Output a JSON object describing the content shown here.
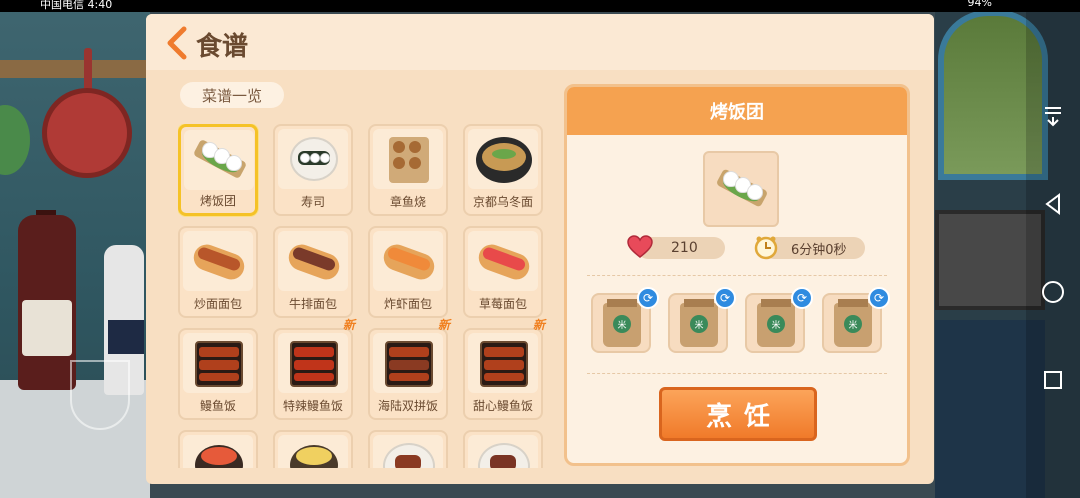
{
  "status_bar": {
    "carrier_time": "中国电信 4:40",
    "battery": "94%"
  },
  "header": {
    "title": "食谱"
  },
  "recipe_list": {
    "label": "菜谱一览",
    "new_badge": "新",
    "items": [
      {
        "name": "烤饭团",
        "selected": true,
        "is_new": false
      },
      {
        "name": "寿司",
        "selected": false,
        "is_new": false
      },
      {
        "name": "章鱼烧",
        "selected": false,
        "is_new": false
      },
      {
        "name": "京都乌冬面",
        "selected": false,
        "is_new": false
      },
      {
        "name": "炒面面包",
        "selected": false,
        "is_new": false
      },
      {
        "name": "牛排面包",
        "selected": false,
        "is_new": false
      },
      {
        "name": "炸虾面包",
        "selected": false,
        "is_new": false
      },
      {
        "name": "草莓面包",
        "selected": false,
        "is_new": false
      },
      {
        "name": "鳗鱼饭",
        "selected": false,
        "is_new": false
      },
      {
        "name": "特辣鳗鱼饭",
        "selected": false,
        "is_new": true
      },
      {
        "name": "海陆双拼饭",
        "selected": false,
        "is_new": true
      },
      {
        "name": "甜心鳗鱼饭",
        "selected": false,
        "is_new": true
      }
    ]
  },
  "detail": {
    "title": "烤饭团",
    "likes": "210",
    "cook_time": "6分钟0秒",
    "ingredient_badge": "米",
    "cook_button": "烹饪"
  },
  "colors": {
    "accent": "#f5a250",
    "button": "#f07a2a",
    "selected_border": "#f5c227",
    "new_badge": "#f08020"
  }
}
